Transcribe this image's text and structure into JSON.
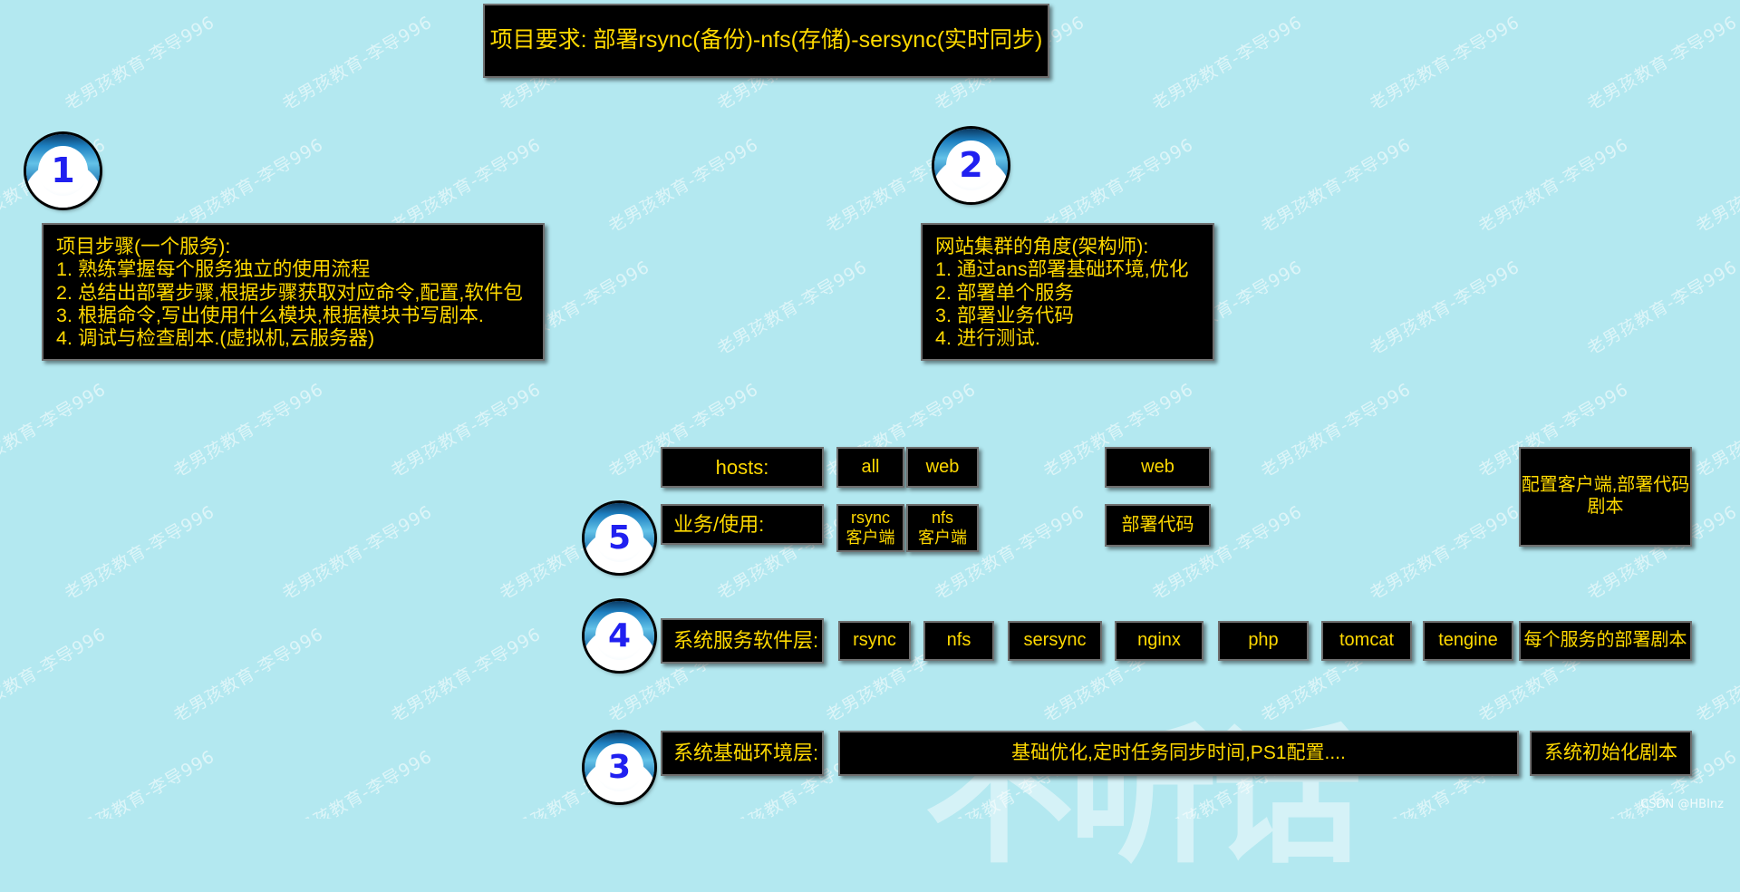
{
  "page": {
    "background_color": "#b3e8f0",
    "box_bg_color": "#000000",
    "box_text_color": "#ffd900",
    "circle_number_color": "#2020f0"
  },
  "watermark": {
    "text": "老男孩教育-李导996",
    "big_text": "不听话",
    "csdn": "CSDN @HBInz"
  },
  "title": {
    "text": "项目要求: 部署rsync(备份)-nfs(存储)-sersync(实时同步)"
  },
  "circles": {
    "one": "1",
    "two": "2",
    "three": "3",
    "four": "4",
    "five": "5"
  },
  "info_box_1": {
    "text": "项目步骤(一个服务):\n1. 熟练掌握每个服务独立的使用流程\n2. 总结出部署步骤,根据步骤获取对应命令,配置,软件包\n3. 根据命令,写出使用什么模块,根据模块书写剧本.\n4. 调试与检查剧本.(虚拟机,云服务器)"
  },
  "info_box_2": {
    "text": "网站集群的角度(架构师):\n1. 通过ans部署基础环境,优化\n2. 部署单个服务\n3. 部署业务代码\n4. 进行测试."
  },
  "row5": {
    "hosts_label": "hosts:",
    "hosts_all": "all",
    "hosts_web": "web",
    "web2": "web",
    "biz_label": "业务/使用:",
    "rsync_client": "rsync\n客户端",
    "nfs_client": "nfs\n客户端",
    "deploy_code": "部署代码",
    "script": "配置客户端,部署代码\n剧本"
  },
  "row4": {
    "label": "系统服务软件层:",
    "services": [
      "rsync",
      "nfs",
      "sersync",
      "nginx",
      "php",
      "tomcat",
      "tengine"
    ],
    "script": "每个服务的部署剧本"
  },
  "row3": {
    "label": "系统基础环境层:",
    "main": "基础优化,定时任务同步时间,PS1配置....",
    "script": "系统初始化剧本"
  }
}
